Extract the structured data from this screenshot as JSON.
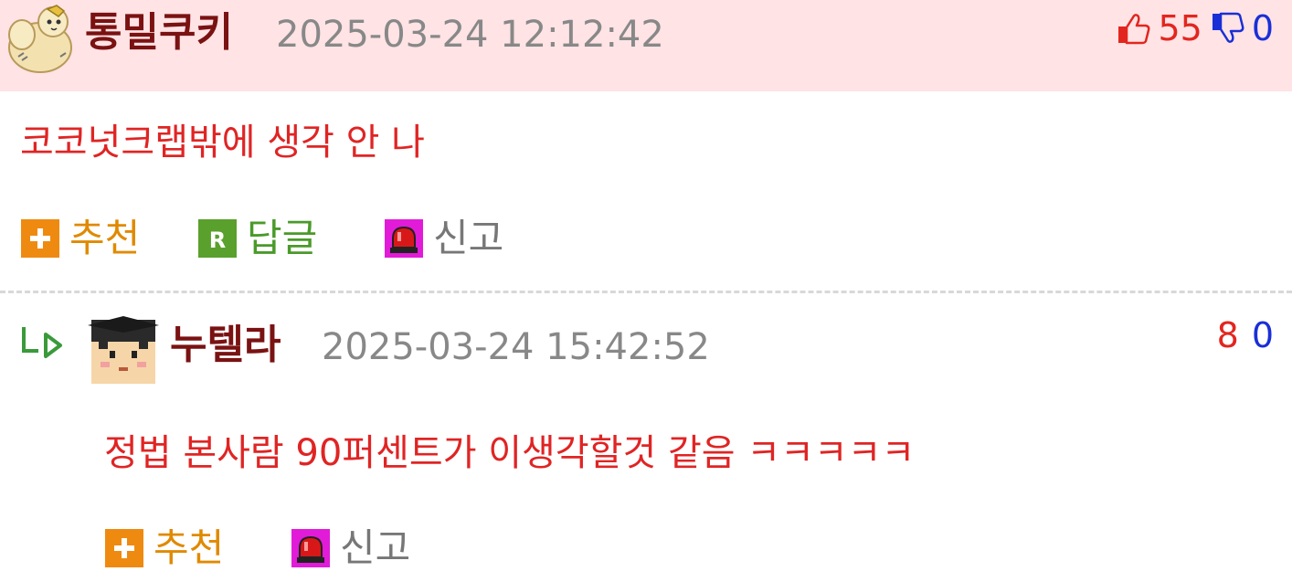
{
  "comment": {
    "author": "통밀쿠키",
    "timestamp": "2025-03-24 12:12:42",
    "upvotes": "55",
    "downvotes": "0",
    "text": "코코넛크랩밖에 생각 안 나",
    "actions": {
      "recommend": "추천",
      "reply": "답글",
      "report": "신고"
    }
  },
  "reply": {
    "author": "누텔라",
    "timestamp": "2025-03-24 15:42:52",
    "upvotes": "8",
    "downvotes": "0",
    "text": "정법 본사람 90퍼센트가 이생각할것 같음 ㅋㅋㅋㅋㅋ",
    "actions": {
      "recommend": "추천",
      "report": "신고"
    }
  },
  "icons": {
    "avatar1": "hamster-avatar",
    "avatar2": "graduate-avatar",
    "thumbs_up": "thumbs-up-icon",
    "thumbs_down": "thumbs-down-icon",
    "recommend": "plus-icon",
    "reply": "r-icon",
    "report": "siren-icon",
    "reply_arrow": "reply-arrow-icon"
  },
  "colors": {
    "header_bg": "#ffe3e5",
    "author": "#7a1212",
    "timestamp": "#888888",
    "content": "#e02424",
    "recommend": "#e08a00",
    "reply": "#4a9a2a",
    "report": "#777777",
    "upvote": "#e2261f",
    "downvote": "#1a2fd6"
  }
}
